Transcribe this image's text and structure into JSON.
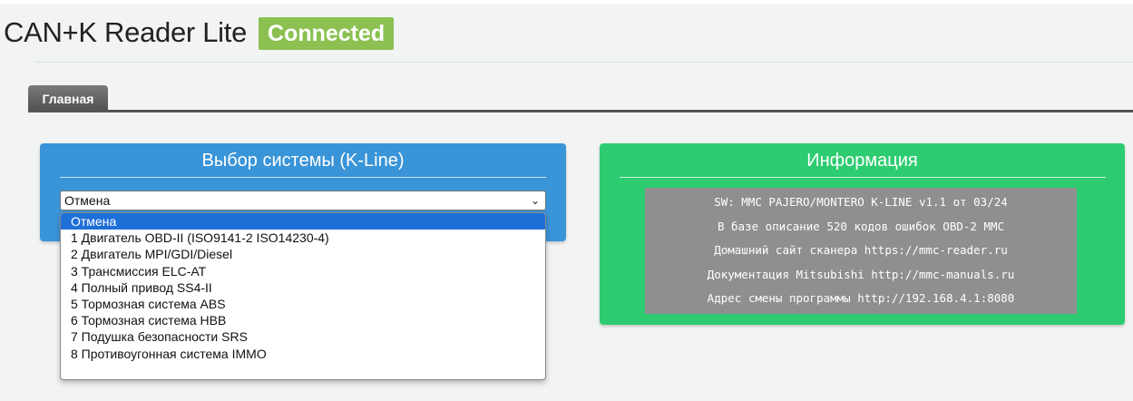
{
  "app": {
    "title": "CAN+K Reader Lite",
    "status": "Connected"
  },
  "tabs": [
    {
      "label": "Главная",
      "active": true
    }
  ],
  "system_panel": {
    "title": "Выбор системы (K-Line)",
    "select": {
      "value": "Отмена",
      "expanded": true,
      "options": [
        "Отмена",
        "1 Двигатель OBD-II (ISO9141-2 ISO14230-4)",
        "2 Двигатель MPI/GDI/Diesel",
        "3 Трансмиссия ELC-AT",
        "4 Полный привод SS4-II",
        "5 Тормозная система ABS",
        "6 Тормозная система HBB",
        "7 Подушка безопасности SRS",
        "8 Противоугонная система IMMO"
      ],
      "selected_index": 0
    }
  },
  "info_panel": {
    "title": "Информация",
    "lines": [
      "SW: MMC PAJERO/MONTERO K-LINE v1.1 от 03/24",
      "В базе описание 520 кодов ошибок OBD-2 MMC",
      "Домашний сайт сканера https://mmc-reader.ru",
      "Документация Mitsubishi http://mmc-manuals.ru",
      "Адрес смены программы http://192.168.4.1:8080"
    ]
  },
  "colors": {
    "status_badge": "#8cc152",
    "system_panel": "#3a94d8",
    "info_panel": "#2ecc71",
    "info_box": "#8f8f8f",
    "dropdown_selected": "#1f6fd8"
  }
}
